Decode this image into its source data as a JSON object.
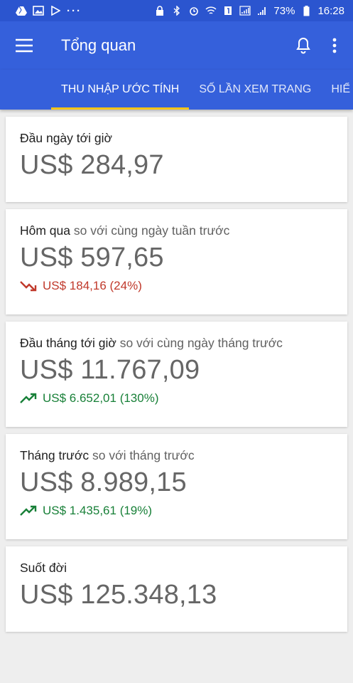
{
  "status_bar": {
    "battery": "73%",
    "time": "16:28",
    "more": "···"
  },
  "app_bar": {
    "title": "Tổng quan",
    "icons": [
      "menu-icon",
      "bell-icon",
      "more-vert-icon"
    ]
  },
  "tabs": [
    {
      "label": "THU NHẬP ƯỚC TÍNH",
      "active": true
    },
    {
      "label": "SỐ LẦN XEM TRANG",
      "active": false
    },
    {
      "label": "HIỂ",
      "active": false
    }
  ],
  "cards": [
    {
      "label": "Đầu ngày tới giờ",
      "sub": "",
      "value": "US$ 284,97",
      "change": ""
    },
    {
      "label": "Hôm qua",
      "sub": "so với cùng ngày tuần trước",
      "value": "US$ 597,65",
      "change": "US$ 184,16 (24%)",
      "trend": "down"
    },
    {
      "label": "Đầu tháng tới giờ",
      "sub": "so với cùng ngày tháng trước",
      "value": "US$ 11.767,09",
      "change": "US$ 6.652,01 (130%)",
      "trend": "up"
    },
    {
      "label": "Tháng trước",
      "sub": "so với tháng trước",
      "value": "US$ 8.989,15",
      "change": "US$ 1.435,61 (19%)",
      "trend": "up"
    },
    {
      "label": "Suốt đời",
      "sub": "",
      "value": "US$ 125.348,13",
      "change": ""
    }
  ],
  "colors": {
    "appbar": "#3560db",
    "statusbar": "#2b55cf",
    "tab_indicator": "#f5c518",
    "down": "#c0392b",
    "up": "#188038"
  }
}
